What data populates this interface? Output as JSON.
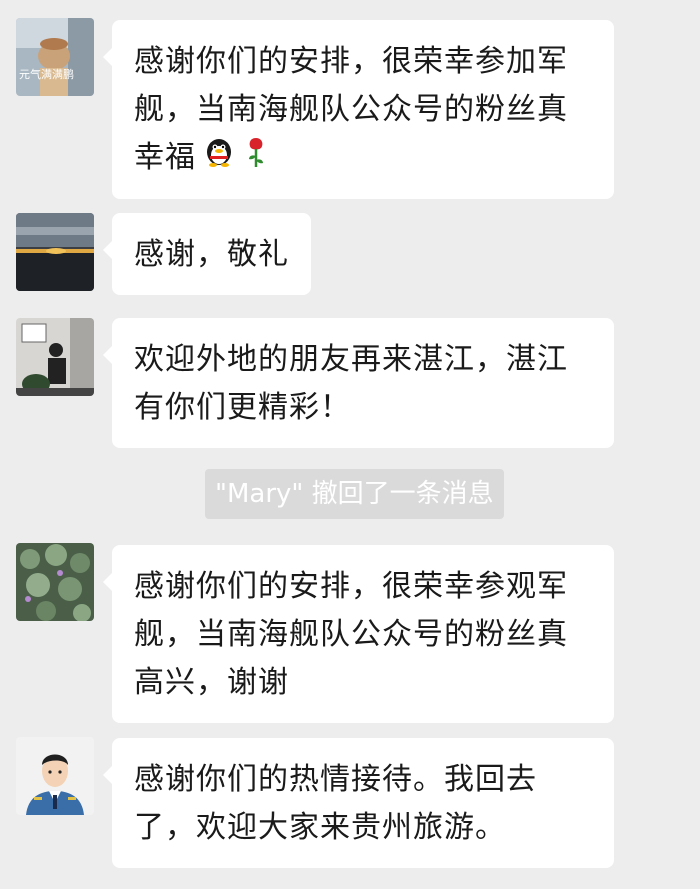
{
  "messages": [
    {
      "avatar_caption": "元气满满鹏",
      "text": "感谢你们的安排，很荣幸参加军舰，当南海舰队公众号的粉丝真幸福",
      "emojis": [
        "penguin-emoji",
        "rose-emoji"
      ]
    },
    {
      "text": "感谢，敬礼"
    },
    {
      "text": "欢迎外地的朋友再来湛江，湛江有你们更精彩！"
    },
    {
      "text": "感谢你们的安排，很荣幸参观军舰，当南海舰队公众号的粉丝真高兴，谢谢"
    },
    {
      "text": "感谢你们的热情接待。我回去了，欢迎大家来贵州旅游。"
    }
  ],
  "system_notice": "\"Mary\" 撤回了一条消息",
  "colors": {
    "background": "#ededed",
    "bubble": "#ffffff",
    "system_pill": "#dadada"
  }
}
